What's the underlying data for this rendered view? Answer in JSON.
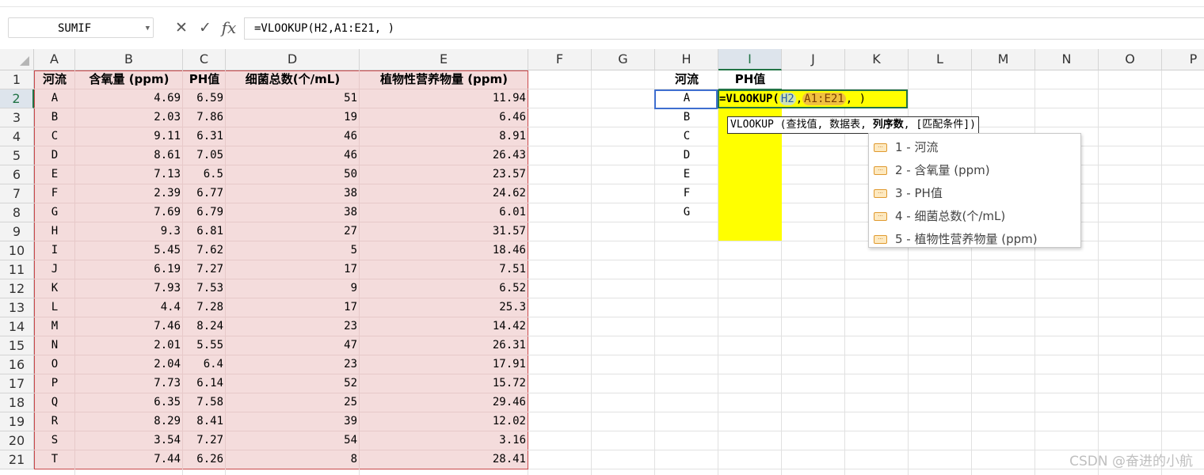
{
  "formula_bar": {
    "name_box": "SUMIF",
    "cancel_icon": "✕",
    "enter_icon": "✓",
    "fx_label": "fx",
    "formula": "=VLOOKUP(H2,A1:E21, )"
  },
  "columns": [
    "A",
    "B",
    "C",
    "D",
    "E",
    "F",
    "G",
    "H",
    "I",
    "J",
    "K",
    "L",
    "M",
    "N",
    "O",
    "P"
  ],
  "rows": [
    "1",
    "2",
    "3",
    "4",
    "5",
    "6",
    "7",
    "8",
    "9",
    "10",
    "11",
    "12",
    "13",
    "14",
    "15",
    "16",
    "17",
    "18",
    "19",
    "20",
    "21"
  ],
  "table": {
    "headers": [
      "河流",
      "含氧量 (ppm)",
      "PH值",
      "细菌总数(个/mL)",
      "植物性营养物量 (ppm)"
    ],
    "rows": [
      [
        "A",
        "4.69",
        "6.59",
        "51",
        "11.94"
      ],
      [
        "B",
        "2.03",
        "7.86",
        "19",
        "6.46"
      ],
      [
        "C",
        "9.11",
        "6.31",
        "46",
        "8.91"
      ],
      [
        "D",
        "8.61",
        "7.05",
        "46",
        "26.43"
      ],
      [
        "E",
        "7.13",
        "6.5",
        "50",
        "23.57"
      ],
      [
        "F",
        "2.39",
        "6.77",
        "38",
        "24.62"
      ],
      [
        "G",
        "7.69",
        "6.79",
        "38",
        "6.01"
      ],
      [
        "H",
        "9.3",
        "6.81",
        "27",
        "31.57"
      ],
      [
        "I",
        "5.45",
        "7.62",
        "5",
        "18.46"
      ],
      [
        "J",
        "6.19",
        "7.27",
        "17",
        "7.51"
      ],
      [
        "K",
        "7.93",
        "7.53",
        "9",
        "6.52"
      ],
      [
        "L",
        "4.4",
        "7.28",
        "17",
        "25.3"
      ],
      [
        "M",
        "7.46",
        "8.24",
        "23",
        "14.42"
      ],
      [
        "N",
        "2.01",
        "5.55",
        "47",
        "26.31"
      ],
      [
        "O",
        "2.04",
        "6.4",
        "23",
        "17.91"
      ],
      [
        "P",
        "7.73",
        "6.14",
        "52",
        "15.72"
      ],
      [
        "Q",
        "6.35",
        "7.58",
        "25",
        "29.46"
      ],
      [
        "R",
        "8.29",
        "8.41",
        "39",
        "12.02"
      ],
      [
        "S",
        "3.54",
        "7.27",
        "54",
        "3.16"
      ],
      [
        "T",
        "7.44",
        "6.26",
        "8",
        "28.41"
      ]
    ]
  },
  "lookup": {
    "header_h": "河流",
    "header_i": "PH值",
    "keys": [
      "A",
      "B",
      "C",
      "D",
      "E",
      "F",
      "G"
    ]
  },
  "editor": {
    "prefix": "=VLOOKUP(",
    "arg1": "H2",
    "comma1": ",",
    "arg2": "A1:E21",
    "rest": ", )"
  },
  "tooltip": {
    "fn": "VLOOKUP",
    "before": " (查找值, 数据表, ",
    "current": "列序数",
    "after": ", [匹配条件])"
  },
  "dropdown": {
    "icon_name": "column-option-icon",
    "items": [
      "1 - 河流",
      "2 - 含氧量 (ppm)",
      "3 - PH值",
      "4 - 细菌总数(个/mL)",
      "5 - 植物性营养物量 (ppm)"
    ]
  },
  "watermark": "CSDN @奋进的小航"
}
